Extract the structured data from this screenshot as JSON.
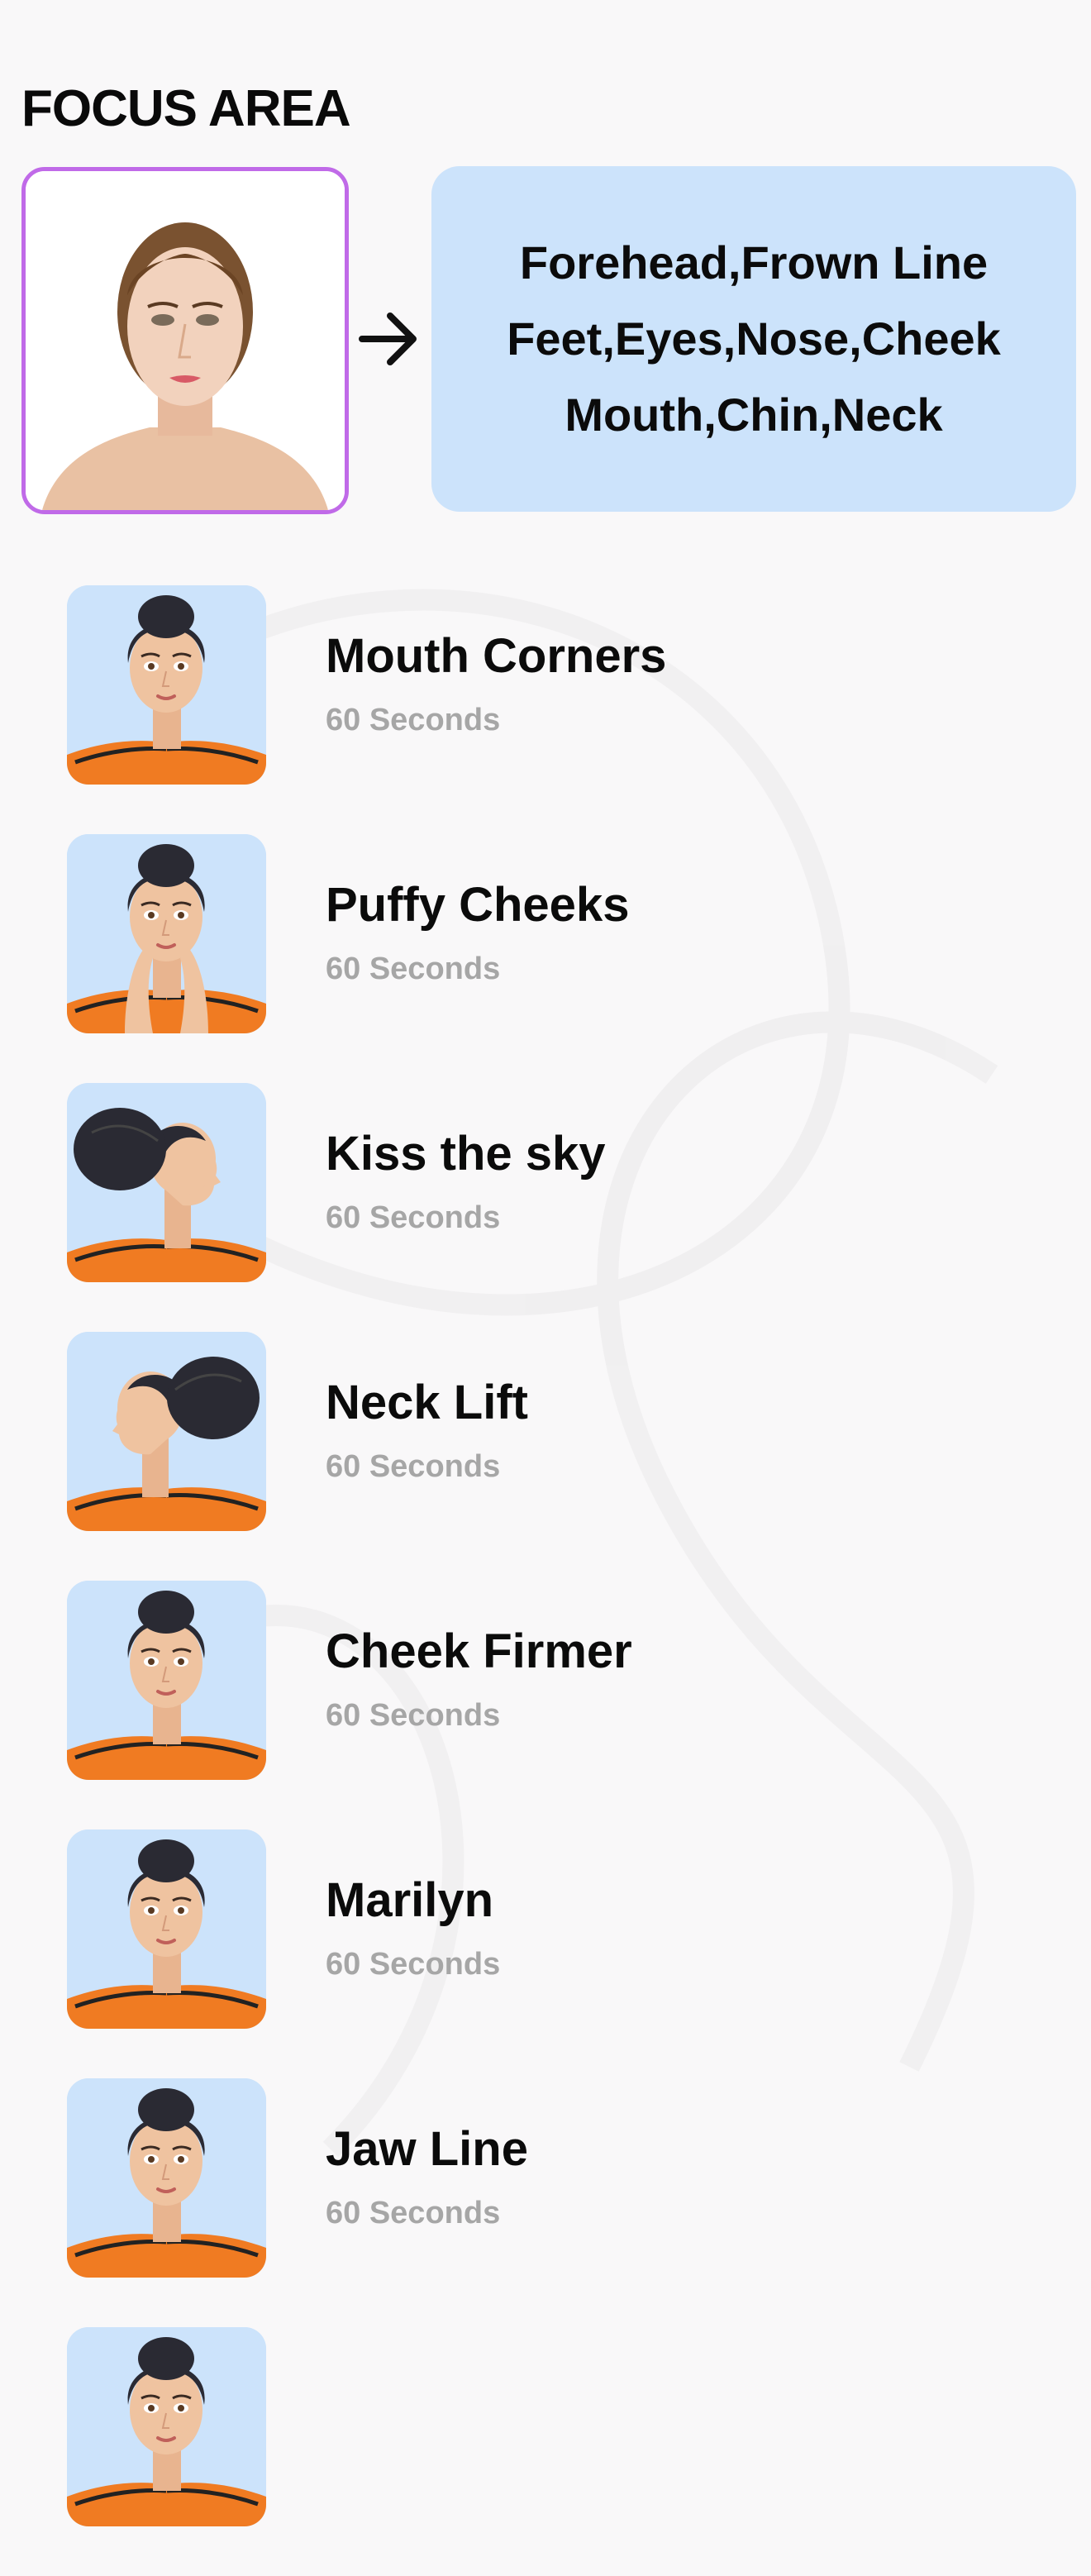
{
  "header": {
    "title": "FOCUS AREA"
  },
  "focus": {
    "areas_lines": [
      "Forehead,Frown Line",
      "Feet,Eyes,Nose,Cheek",
      "Mouth,Chin,Neck"
    ]
  },
  "exercises": [
    {
      "name": "Mouth Corners",
      "duration": "60 Seconds",
      "pose": "front"
    },
    {
      "name": "Puffy Cheeks",
      "duration": "60 Seconds",
      "pose": "hands-cheeks"
    },
    {
      "name": "Kiss the sky",
      "duration": "60 Seconds",
      "pose": "profile-right"
    },
    {
      "name": "Neck Lift",
      "duration": "60 Seconds",
      "pose": "profile-left"
    },
    {
      "name": "Cheek Firmer",
      "duration": "60 Seconds",
      "pose": "front"
    },
    {
      "name": "Marilyn",
      "duration": "60 Seconds",
      "pose": "front"
    },
    {
      "name": "Jaw Line",
      "duration": "60 Seconds",
      "pose": "front"
    },
    {
      "name": "",
      "duration": "",
      "pose": "front"
    }
  ],
  "colors": {
    "accent_border": "#c06ae8",
    "card_bg": "#cce3fb",
    "shirt": "#f07b22",
    "hair": "#2a2a33",
    "muted_text": "#a6a6a6"
  }
}
